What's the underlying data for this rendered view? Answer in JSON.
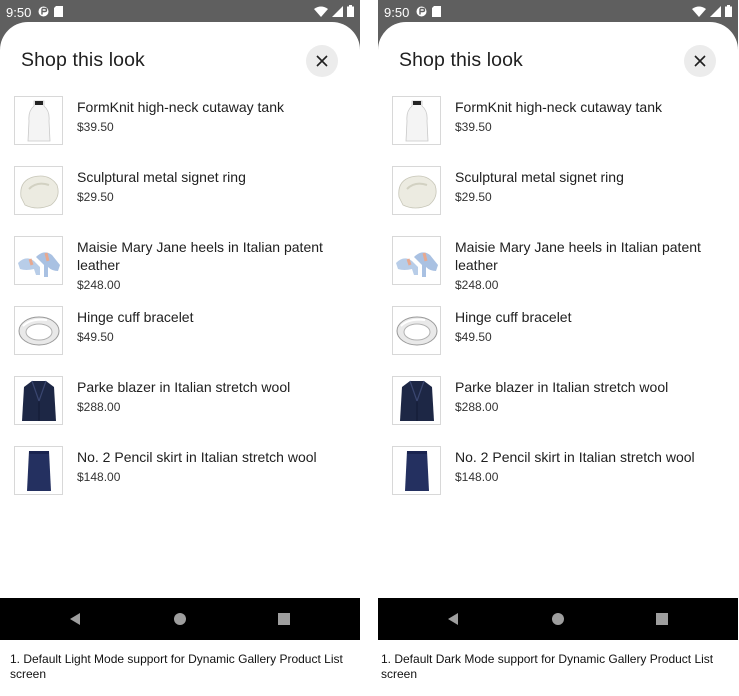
{
  "status": {
    "time": "9:50"
  },
  "sheet": {
    "title": "Shop this look"
  },
  "products": [
    {
      "name": "FormKnit high-neck cutaway tank",
      "price": "$39.50"
    },
    {
      "name": "Sculptural metal signet ring",
      "price": "$29.50"
    },
    {
      "name": "Maisie Mary Jane heels in Italian patent leather",
      "price": "$248.00"
    },
    {
      "name": "Hinge cuff bracelet",
      "price": "$49.50"
    },
    {
      "name": "Parke blazer in Italian stretch wool",
      "price": "$288.00"
    },
    {
      "name": "No. 2 Pencil skirt in Italian stretch wool",
      "price": "$148.00"
    }
  ],
  "captions": {
    "left": "1. Default Light Mode support for Dynamic Gallery Product List screen",
    "right": "1. Default Dark Mode support for Dynamic Gallery Product List screen"
  },
  "colors": {
    "status_bar": "#5f5f5f",
    "nav_bar": "#000000",
    "close_button_bg": "#ececec",
    "blazer": "#1d2745",
    "skirt": "#243060"
  },
  "icons": {
    "status": [
      "signal-icon",
      "wifi-icon",
      "battery-icon",
      "notification-icon",
      "sd-card-icon"
    ],
    "close": "close-icon",
    "nav": [
      "back-icon",
      "home-icon",
      "recents-icon"
    ]
  }
}
